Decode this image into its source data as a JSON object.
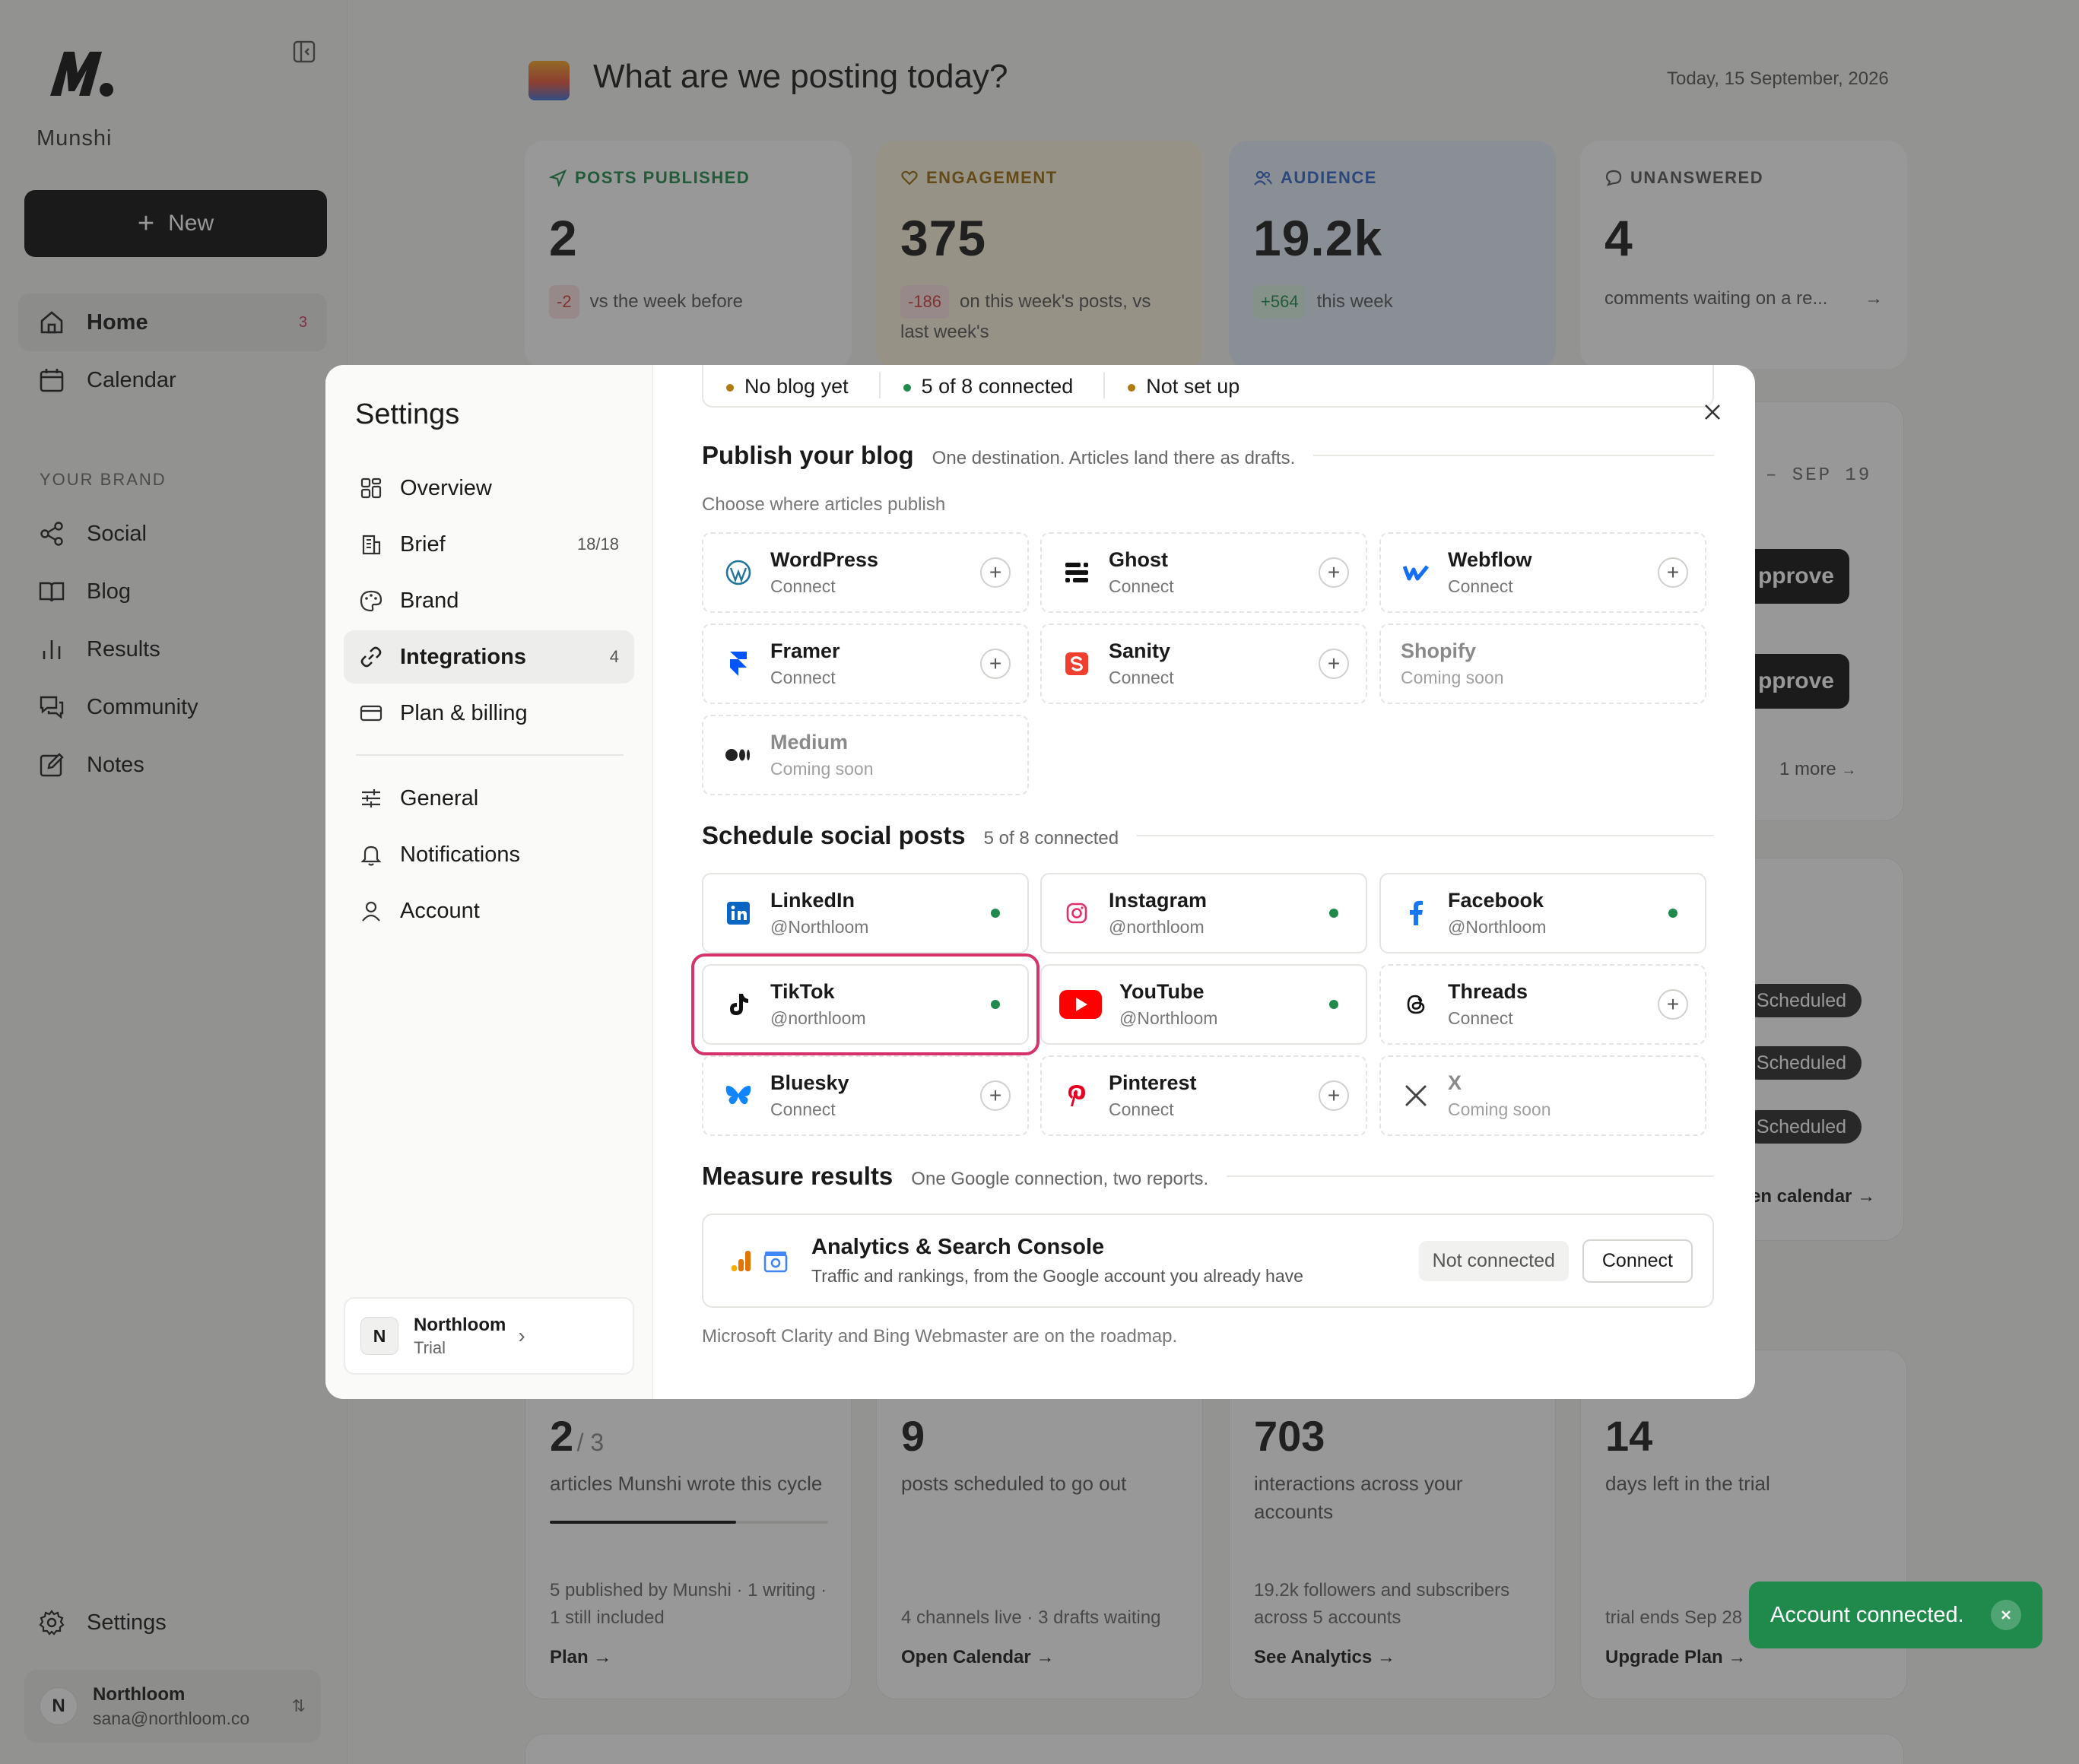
{
  "app": {
    "name": "Munshi"
  },
  "sidebar": {
    "new_label": "New",
    "items": [
      {
        "label": "Home",
        "badge": "3"
      },
      {
        "label": "Calendar"
      }
    ],
    "section_label": "YOUR BRAND",
    "brand_items": [
      {
        "label": "Social"
      },
      {
        "label": "Blog"
      },
      {
        "label": "Results"
      },
      {
        "label": "Community"
      },
      {
        "label": "Notes"
      }
    ],
    "settings_label": "Settings",
    "user": {
      "initial": "N",
      "name": "Northloom",
      "email": "sana@northloom.co"
    }
  },
  "header": {
    "title": "What are we posting today?",
    "date": "Today, 15 September, 2026"
  },
  "stats": [
    {
      "label": "POSTS PUBLISHED",
      "value": "2",
      "delta": "-2",
      "sub": "vs the week before"
    },
    {
      "label": "ENGAGEMENT",
      "value": "375",
      "delta": "-186",
      "sub": "on this week's posts, vs last week's"
    },
    {
      "label": "AUDIENCE",
      "value": "19.2k",
      "delta": "+564",
      "sub": "this week"
    },
    {
      "label": "UNANSWERED",
      "value": "4",
      "sub": "comments waiting on a re..."
    }
  ],
  "behind": {
    "range_end": "– SEP 19",
    "approve_label": "pprove",
    "more": "1 more",
    "scheduled_label": "Scheduled",
    "calendar_link": "en calendar →"
  },
  "bottom_cards": [
    {
      "value": "2",
      "value_suffix": "/ 3",
      "desc": "articles Munshi wrote this cycle",
      "progress": 0.67,
      "foot": "5 published by Munshi · 1 writing · 1 still included",
      "link": "Plan →"
    },
    {
      "value": "9",
      "desc": "posts scheduled to go out",
      "foot": "4 channels live · 3 drafts waiting",
      "link": "Open Calendar →"
    },
    {
      "value": "703",
      "desc": "interactions across your accounts",
      "foot": "19.2k followers and subscribers across 5 accounts",
      "link": "See Analytics →"
    },
    {
      "value": "14",
      "desc": "days left in the trial",
      "foot": "trial ends Sep 28",
      "link": "Upgrade Plan →"
    }
  ],
  "toast": {
    "message": "Account connected."
  },
  "settings": {
    "title": "Settings",
    "nav": [
      {
        "label": "Overview"
      },
      {
        "label": "Brief",
        "count": "18/18"
      },
      {
        "label": "Brand"
      },
      {
        "label": "Integrations",
        "count": "4"
      },
      {
        "label": "Plan & billing"
      },
      {
        "label": "General"
      },
      {
        "label": "Notifications"
      },
      {
        "label": "Account"
      }
    ],
    "workspace": {
      "initial": "N",
      "name": "Northloom",
      "plan": "Trial"
    },
    "status_strip": [
      "No blog yet",
      "5 of 8 connected",
      "Not set up"
    ],
    "blog": {
      "title": "Publish your blog",
      "subtitle": "One destination. Articles land there as drafts.",
      "choose_label": "Choose where articles publish",
      "tiles": [
        {
          "name": "WordPress",
          "sub": "Connect",
          "icon": "wordpress-icon"
        },
        {
          "name": "Ghost",
          "sub": "Connect",
          "icon": "ghost-icon"
        },
        {
          "name": "Webflow",
          "sub": "Connect",
          "icon": "webflow-icon"
        },
        {
          "name": "Framer",
          "sub": "Connect",
          "icon": "framer-icon"
        },
        {
          "name": "Sanity",
          "sub": "Connect",
          "icon": "sanity-icon"
        },
        {
          "name": "Shopify",
          "sub": "Coming soon",
          "icon": "shopify-icon"
        },
        {
          "name": "Medium",
          "sub": "Coming soon",
          "icon": "medium-icon"
        }
      ]
    },
    "social": {
      "title": "Schedule social posts",
      "subtitle": "5 of 8 connected",
      "tiles": [
        {
          "name": "LinkedIn",
          "sub": "@Northloom",
          "icon": "linkedin-icon"
        },
        {
          "name": "Instagram",
          "sub": "@northloom",
          "icon": "instagram-icon"
        },
        {
          "name": "Facebook",
          "sub": "@Northloom",
          "icon": "facebook-icon"
        },
        {
          "name": "TikTok",
          "sub": "@northloom",
          "icon": "tiktok-icon"
        },
        {
          "name": "YouTube",
          "sub": "@Northloom",
          "icon": "youtube-icon"
        },
        {
          "name": "Threads",
          "sub": "Connect",
          "icon": "threads-icon"
        },
        {
          "name": "Bluesky",
          "sub": "Connect",
          "icon": "bluesky-icon"
        },
        {
          "name": "Pinterest",
          "sub": "Connect",
          "icon": "pinterest-icon"
        },
        {
          "name": "X",
          "sub": "Coming soon",
          "icon": "x-icon"
        }
      ]
    },
    "measure": {
      "title": "Measure results",
      "subtitle": "One Google connection, two reports.",
      "analytics_title": "Analytics & Search Console",
      "analytics_sub": "Traffic and rankings, from the Google account you already have",
      "status": "Not connected",
      "connect_label": "Connect",
      "footnote": "Microsoft Clarity and Bing Webmaster are on the roadmap."
    }
  },
  "colors": {
    "success": "#1f8a4c",
    "highlight": "#d6336c",
    "youtube": "#ff0000"
  }
}
